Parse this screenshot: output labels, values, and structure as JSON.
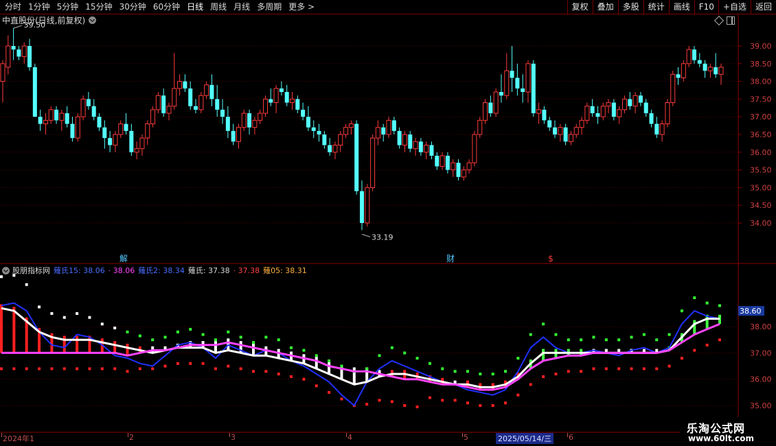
{
  "toolbar": {
    "periods": [
      "分时",
      "1分钟",
      "5分钟",
      "15分钟",
      "30分钟",
      "60分钟",
      "日线",
      "周线",
      "月线",
      "多周期",
      "更多 >"
    ],
    "active_period": "日线",
    "right_buttons": [
      "复权",
      "叠加",
      "多股",
      "统计",
      "画线",
      "F10",
      "+自选",
      "返回"
    ]
  },
  "main_chart": {
    "title": "中直股份(日线,前复权)",
    "high_label": "39.50",
    "low_label": "33.19",
    "markers": [
      "解",
      "财",
      "$"
    ],
    "yticks": [
      "39.00",
      "38.50",
      "38.00",
      "37.50",
      "37.00",
      "36.50",
      "36.00",
      "35.50",
      "35.00",
      "34.50",
      "34.00"
    ]
  },
  "indicator": {
    "name": "股朋指标网",
    "values": [
      {
        "text": "薙氏15: 38.06",
        "color": "#4a6cff"
      },
      {
        "text": "· 38.06",
        "color": "#ff44ff"
      },
      {
        "text": "薙氏2: 38.34",
        "color": "#4a6cff"
      },
      {
        "text": "薙氏: 37.38",
        "color": "#d8d8d8"
      },
      {
        "text": "· 37.38",
        "color": "#ff4444"
      },
      {
        "text": "薙05: 38.31",
        "color": "#ffb040"
      }
    ],
    "yticks": [
      "38.00",
      "37.00",
      "36.00",
      "35.00"
    ],
    "current_value": "38.60"
  },
  "date_axis": {
    "labels": [
      "2024年1",
      "2",
      "3",
      "4",
      "5",
      "6"
    ],
    "selected": "2025/05/14/三"
  },
  "watermark": {
    "title": "乐淘公式网",
    "url": "www.60lt.com"
  },
  "chart_data": [
    {
      "type": "candlestick",
      "title": "中直股份(日线,前复权)",
      "ylim": [
        33.6,
        39.3
      ],
      "ohlc": [
        [
          38.0,
          38.6,
          37.4,
          38.5
        ],
        [
          38.4,
          39.3,
          38.2,
          39.0
        ],
        [
          39.0,
          39.5,
          38.6,
          38.9
        ],
        [
          38.9,
          39.0,
          38.6,
          38.7
        ],
        [
          38.7,
          39.1,
          38.5,
          39.0
        ],
        [
          39.0,
          39.2,
          38.3,
          38.4
        ],
        [
          38.4,
          38.5,
          37.0,
          37.0
        ],
        [
          37.0,
          37.2,
          36.6,
          36.8
        ],
        [
          36.8,
          37.1,
          36.5,
          36.9
        ],
        [
          36.9,
          37.3,
          36.8,
          37.2
        ],
        [
          37.2,
          37.3,
          36.8,
          36.9
        ],
        [
          36.9,
          37.2,
          36.6,
          37.1
        ],
        [
          37.1,
          37.3,
          36.7,
          36.8
        ],
        [
          36.8,
          37.0,
          36.3,
          36.4
        ],
        [
          36.4,
          37.1,
          36.3,
          37.0
        ],
        [
          37.0,
          37.6,
          36.9,
          37.5
        ],
        [
          37.5,
          37.7,
          37.2,
          37.3
        ],
        [
          37.3,
          37.5,
          36.9,
          37.0
        ],
        [
          37.0,
          37.1,
          36.6,
          36.7
        ],
        [
          36.7,
          36.9,
          36.1,
          36.4
        ],
        [
          36.4,
          36.6,
          36.0,
          36.2
        ],
        [
          36.2,
          36.6,
          36.0,
          36.5
        ],
        [
          36.5,
          36.9,
          36.4,
          36.8
        ],
        [
          36.8,
          37.1,
          36.5,
          36.6
        ],
        [
          36.6,
          36.8,
          35.9,
          36.0
        ],
        [
          36.0,
          36.3,
          35.8,
          36.1
        ],
        [
          36.1,
          36.5,
          35.9,
          36.4
        ],
        [
          36.4,
          36.9,
          36.2,
          36.8
        ],
        [
          36.8,
          37.3,
          36.7,
          37.2
        ],
        [
          37.2,
          37.7,
          37.1,
          37.6
        ],
        [
          37.6,
          37.8,
          37.0,
          37.1
        ],
        [
          37.1,
          37.4,
          36.9,
          37.3
        ],
        [
          37.3,
          38.8,
          37.2,
          37.8
        ],
        [
          37.8,
          38.2,
          37.6,
          38.0
        ],
        [
          38.0,
          38.2,
          37.7,
          37.8
        ],
        [
          37.8,
          38.0,
          37.2,
          37.3
        ],
        [
          37.3,
          37.5,
          37.1,
          37.2
        ],
        [
          37.2,
          37.7,
          37.1,
          37.6
        ],
        [
          37.6,
          38.0,
          37.5,
          37.9
        ],
        [
          37.9,
          38.2,
          37.3,
          37.5
        ],
        [
          37.5,
          37.9,
          37.0,
          37.2
        ],
        [
          37.2,
          37.5,
          36.8,
          37.0
        ],
        [
          37.0,
          37.3,
          36.4,
          36.6
        ],
        [
          36.6,
          36.8,
          36.2,
          36.3
        ],
        [
          36.3,
          36.8,
          36.1,
          36.7
        ],
        [
          36.7,
          37.2,
          36.6,
          37.1
        ],
        [
          37.1,
          37.2,
          36.5,
          36.7
        ],
        [
          36.7,
          37.0,
          36.5,
          36.9
        ],
        [
          36.9,
          37.2,
          36.8,
          37.1
        ],
        [
          37.1,
          37.6,
          37.0,
          37.5
        ],
        [
          37.5,
          37.8,
          37.3,
          37.4
        ],
        [
          37.4,
          37.9,
          37.1,
          37.8
        ],
        [
          37.8,
          38.0,
          37.6,
          37.7
        ],
        [
          37.7,
          37.9,
          37.3,
          37.4
        ],
        [
          37.4,
          37.7,
          37.2,
          37.5
        ],
        [
          37.5,
          37.6,
          37.1,
          37.2
        ],
        [
          37.2,
          37.4,
          36.9,
          37.0
        ],
        [
          37.0,
          37.3,
          36.6,
          36.7
        ],
        [
          36.7,
          36.9,
          36.4,
          36.6
        ],
        [
          36.6,
          36.8,
          36.3,
          36.5
        ],
        [
          36.5,
          36.6,
          36.1,
          36.2
        ],
        [
          36.2,
          36.4,
          35.9,
          36.0
        ],
        [
          36.0,
          36.3,
          35.8,
          36.2
        ],
        [
          36.2,
          36.6,
          36.0,
          36.5
        ],
        [
          36.5,
          36.8,
          36.4,
          36.7
        ],
        [
          36.7,
          36.9,
          36.5,
          36.8
        ],
        [
          36.8,
          36.9,
          34.8,
          34.9
        ],
        [
          34.9,
          35.2,
          33.8,
          34.0
        ],
        [
          34.0,
          35.1,
          33.9,
          35.0
        ],
        [
          35.0,
          36.5,
          34.9,
          36.4
        ],
        [
          36.4,
          36.9,
          36.2,
          36.7
        ],
        [
          36.7,
          36.8,
          36.3,
          36.5
        ],
        [
          36.5,
          37.0,
          36.4,
          36.9
        ],
        [
          36.9,
          37.0,
          36.5,
          36.6
        ],
        [
          36.6,
          36.7,
          36.1,
          36.2
        ],
        [
          36.2,
          36.6,
          36.0,
          36.5
        ],
        [
          36.5,
          36.6,
          36.0,
          36.1
        ],
        [
          36.1,
          36.4,
          35.9,
          36.3
        ],
        [
          36.3,
          36.4,
          35.9,
          36.0
        ],
        [
          36.0,
          36.3,
          35.8,
          36.2
        ],
        [
          36.2,
          36.3,
          35.8,
          35.9
        ],
        [
          35.9,
          36.0,
          35.5,
          35.6
        ],
        [
          35.6,
          36.0,
          35.5,
          35.9
        ],
        [
          35.9,
          36.0,
          35.4,
          35.5
        ],
        [
          35.5,
          35.8,
          35.3,
          35.7
        ],
        [
          35.7,
          35.8,
          35.2,
          35.3
        ],
        [
          35.3,
          35.6,
          35.2,
          35.5
        ],
        [
          35.5,
          35.8,
          35.4,
          35.7
        ],
        [
          35.7,
          36.6,
          35.6,
          36.5
        ],
        [
          36.5,
          37.0,
          36.4,
          36.9
        ],
        [
          36.9,
          37.5,
          36.8,
          37.4
        ],
        [
          37.4,
          37.6,
          37.0,
          37.1
        ],
        [
          37.1,
          37.8,
          37.0,
          37.7
        ],
        [
          37.7,
          38.2,
          37.4,
          37.6
        ],
        [
          37.6,
          38.8,
          37.5,
          38.3
        ],
        [
          38.3,
          39.0,
          37.7,
          38.1
        ],
        [
          38.1,
          38.5,
          37.6,
          37.8
        ],
        [
          37.8,
          38.2,
          37.4,
          37.7
        ],
        [
          37.7,
          38.6,
          37.4,
          38.5
        ],
        [
          38.5,
          38.6,
          37.0,
          37.1
        ],
        [
          37.1,
          37.4,
          36.8,
          37.2
        ],
        [
          37.2,
          37.3,
          36.8,
          36.9
        ],
        [
          36.9,
          37.0,
          36.6,
          36.7
        ],
        [
          36.7,
          36.9,
          36.4,
          36.5
        ],
        [
          36.5,
          36.8,
          36.3,
          36.7
        ],
        [
          36.7,
          36.8,
          36.2,
          36.3
        ],
        [
          36.3,
          36.6,
          36.2,
          36.5
        ],
        [
          36.5,
          36.8,
          36.4,
          36.7
        ],
        [
          36.7,
          37.0,
          36.5,
          36.9
        ],
        [
          36.9,
          37.4,
          36.8,
          37.3
        ],
        [
          37.3,
          37.5,
          37.0,
          37.1
        ],
        [
          37.1,
          37.3,
          36.8,
          37.0
        ],
        [
          37.0,
          37.4,
          36.9,
          37.3
        ],
        [
          37.3,
          37.5,
          37.1,
          37.4
        ],
        [
          37.4,
          37.5,
          36.9,
          37.0
        ],
        [
          37.0,
          37.3,
          36.8,
          37.2
        ],
        [
          37.2,
          37.6,
          37.1,
          37.5
        ],
        [
          37.5,
          37.7,
          37.2,
          37.3
        ],
        [
          37.3,
          37.7,
          37.1,
          37.6
        ],
        [
          37.6,
          37.7,
          37.3,
          37.4
        ],
        [
          37.4,
          37.5,
          37.0,
          37.1
        ],
        [
          37.1,
          37.2,
          36.7,
          36.8
        ],
        [
          36.8,
          37.0,
          36.4,
          36.5
        ],
        [
          36.5,
          36.9,
          36.3,
          36.8
        ],
        [
          36.8,
          37.5,
          36.7,
          37.4
        ],
        [
          37.4,
          38.3,
          37.3,
          38.2
        ],
        [
          38.2,
          38.4,
          37.9,
          38.1
        ],
        [
          38.1,
          38.6,
          38.0,
          38.5
        ],
        [
          38.5,
          39.0,
          38.4,
          38.9
        ],
        [
          38.9,
          39.0,
          38.5,
          38.6
        ],
        [
          38.6,
          38.8,
          38.4,
          38.5
        ],
        [
          38.5,
          38.6,
          38.1,
          38.3
        ],
        [
          38.3,
          38.5,
          38.1,
          38.4
        ],
        [
          38.4,
          38.8,
          38.1,
          38.2
        ],
        [
          38.2,
          38.5,
          37.9,
          38.4
        ]
      ]
    },
    {
      "type": "line",
      "title": "股朋指标网",
      "ylim": [
        34.7,
        39.1
      ],
      "series": [
        {
          "name": "薙氏15",
          "color": "#2030ff",
          "values": [
            38.8,
            38.9,
            38.6,
            37.8,
            37.3,
            37.2,
            37.7,
            37.6,
            37.3,
            36.9,
            36.8,
            36.6,
            36.5,
            36.9,
            37.3,
            37.4,
            37.2,
            36.8,
            37.3,
            37.1,
            36.9,
            37.1,
            37.0,
            36.7,
            36.5,
            36.2,
            35.9,
            35.4,
            35.0,
            35.9,
            36.4,
            36.7,
            36.5,
            36.3,
            36.1,
            35.9,
            35.8,
            35.6,
            35.5,
            35.4,
            35.6,
            36.3,
            37.2,
            37.6,
            37.2,
            37.0,
            37.0,
            37.1,
            37.0,
            36.9,
            37.1,
            37.2,
            37.0,
            37.2,
            38.1,
            38.6,
            38.4,
            38.3
          ]
        },
        {
          "name": "薙氏",
          "color": "#ff44ff",
          "values": [
            37.0,
            37.0,
            37.0,
            37.0,
            37.0,
            37.0,
            37.0,
            37.0,
            37.0,
            37.0,
            36.9,
            37.0,
            37.1,
            37.1,
            37.2,
            37.3,
            37.3,
            37.3,
            37.4,
            37.3,
            37.2,
            37.1,
            37.0,
            36.9,
            36.8,
            36.7,
            36.5,
            36.4,
            36.3,
            36.3,
            36.2,
            36.1,
            36.0,
            36.0,
            35.9,
            35.8,
            35.8,
            35.7,
            35.6,
            35.6,
            35.7,
            36.0,
            36.4,
            36.7,
            36.8,
            36.9,
            36.9,
            37.0,
            37.0,
            37.0,
            37.0,
            37.0,
            37.0,
            37.1,
            37.4,
            37.7,
            37.9,
            38.1
          ]
        },
        {
          "name": "薙氏2",
          "color": "#ffffff",
          "values": [
            38.7,
            38.6,
            38.2,
            37.8,
            37.6,
            37.5,
            37.5,
            37.5,
            37.4,
            37.3,
            37.2,
            37.1,
            37.0,
            37.1,
            37.2,
            37.2,
            37.2,
            37.0,
            37.1,
            37.0,
            36.9,
            36.9,
            36.8,
            36.7,
            36.6,
            36.4,
            36.2,
            36.0,
            35.8,
            35.9,
            36.1,
            36.2,
            36.2,
            36.1,
            36.0,
            35.9,
            35.8,
            35.8,
            35.7,
            35.7,
            35.8,
            36.1,
            36.6,
            37.0,
            37.0,
            37.0,
            37.0,
            37.0,
            37.0,
            37.0,
            37.0,
            37.0,
            37.0,
            37.1,
            37.6,
            38.1,
            38.3,
            38.3
          ]
        }
      ]
    }
  ]
}
